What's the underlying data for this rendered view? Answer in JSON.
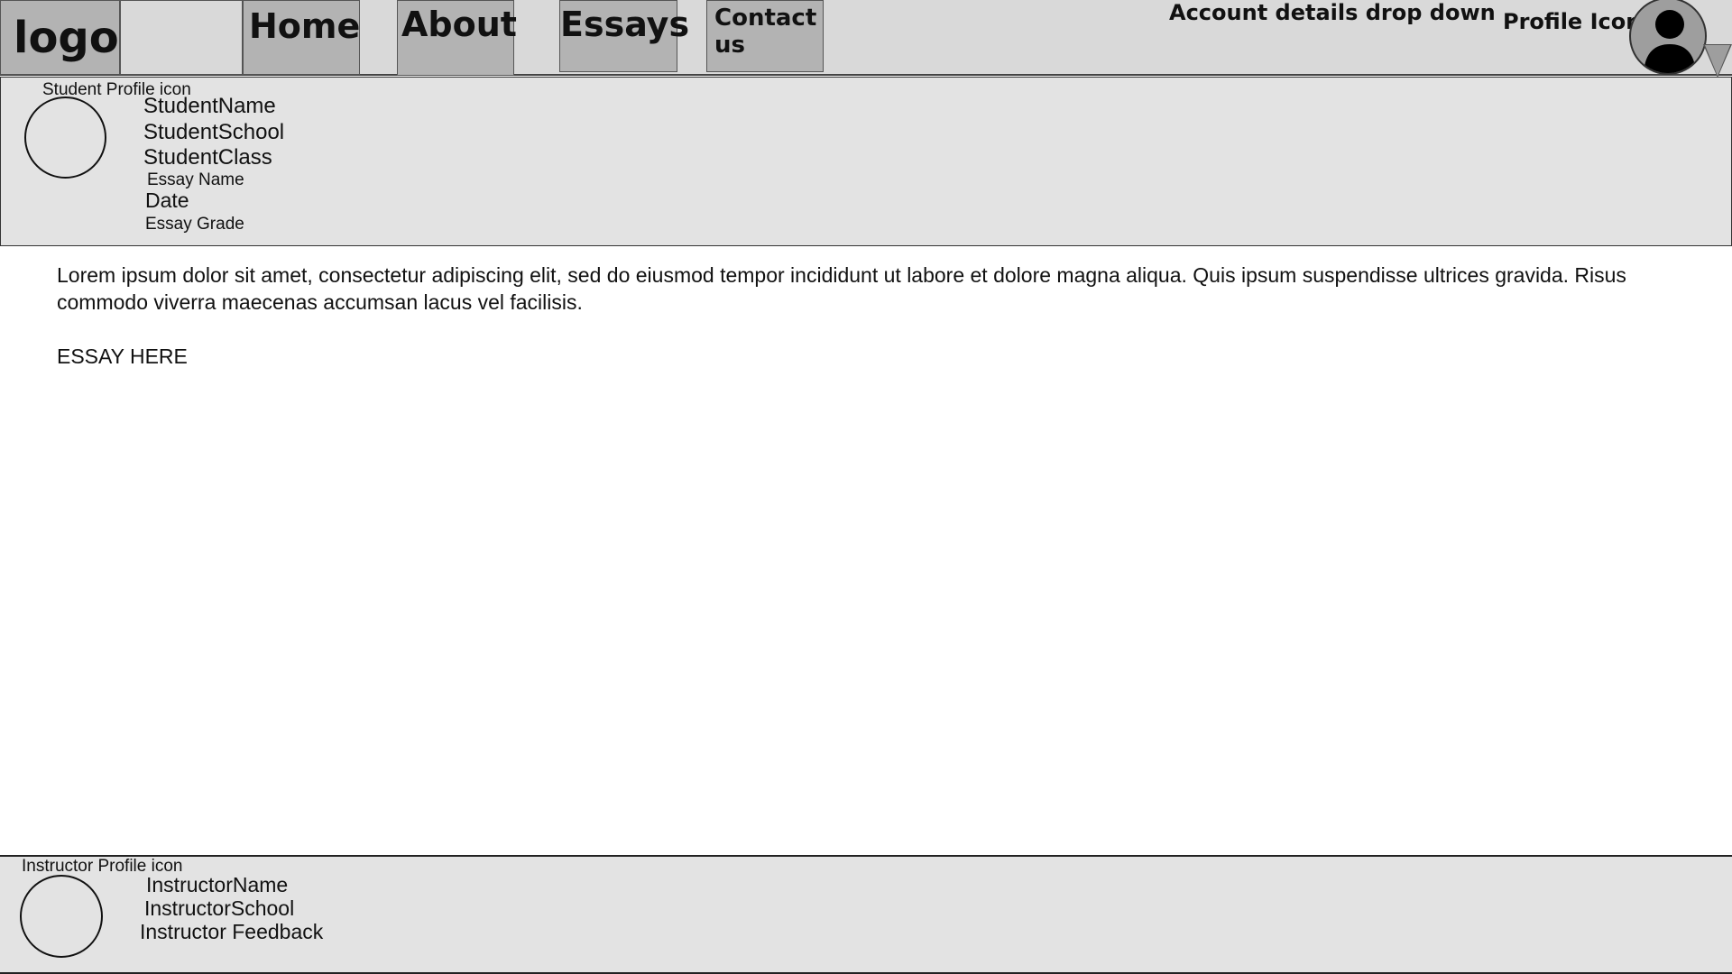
{
  "nav": {
    "logo": "logo",
    "home": "Home",
    "about": "About",
    "essays": "Essays",
    "contact": "Contact us"
  },
  "account": {
    "dropdown_label": "Account details drop down",
    "profile_label": "Profile Icon",
    "avatar_icon": "user-silhouette-icon",
    "arrow_icon": "triangle-down-icon"
  },
  "student": {
    "icon_caption": "Student Profile icon",
    "name": "StudentName",
    "school": "StudentSchool",
    "class": "StudentClass",
    "essay_name": "Essay Name",
    "date": "Date",
    "essay_grade": "Essay Grade"
  },
  "essay": {
    "intro": "Lorem ipsum dolor sit amet, consectetur adipiscing elit, sed do eiusmod tempor incididunt ut labore et dolore magna aliqua. Quis ipsum suspendisse ultrices gravida. Risus commodo viverra maecenas accumsan lacus vel facilisis.",
    "placeholder": "ESSAY HERE"
  },
  "instructor": {
    "icon_caption": "Instructor Profile icon",
    "name": "InstructorName",
    "school": "InstructorSchool",
    "feedback": "Instructor Feedback"
  },
  "colors": {
    "nav_bg": "#d9d9d9",
    "nav_button": "#b3b3b3",
    "panel_bg": "#e3e3e3",
    "avatar_bg": "#9e9e9e"
  }
}
